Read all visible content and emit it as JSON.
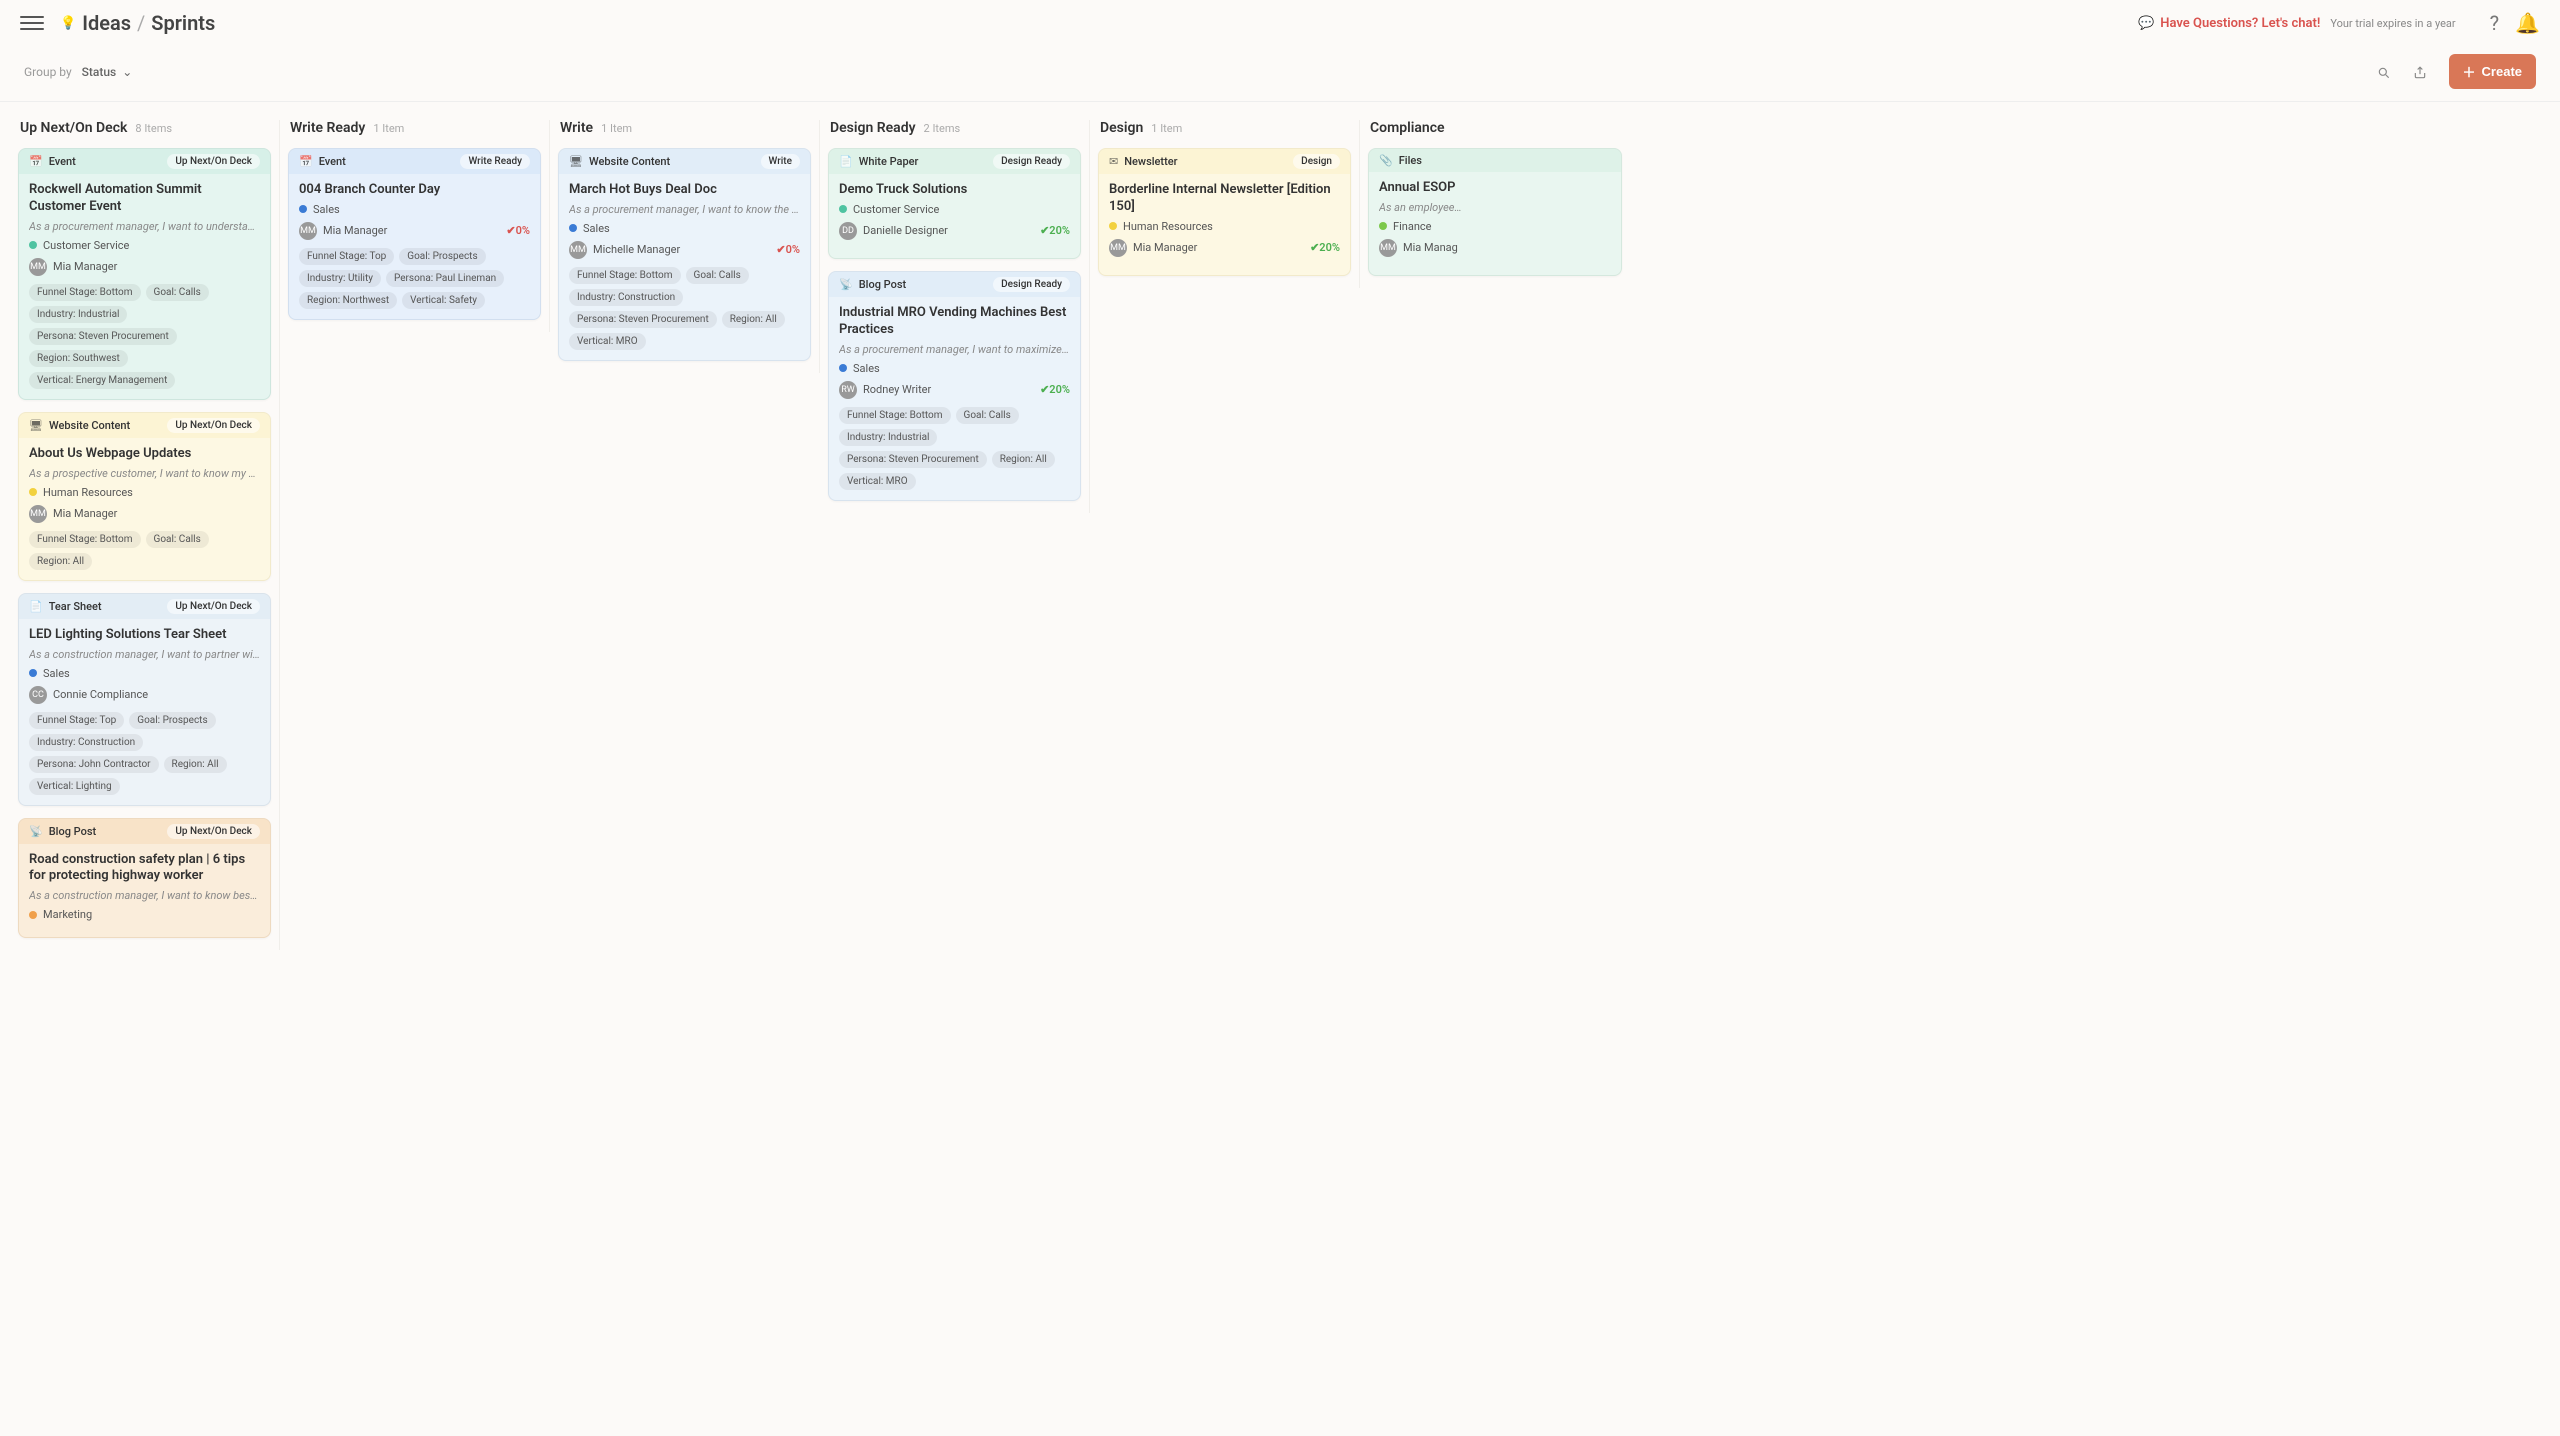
{
  "breadcrumb": {
    "root": "Ideas",
    "current": "Sprints"
  },
  "header": {
    "chat": "Have Questions? Let's chat!",
    "trial": "Your trial expires in a year"
  },
  "toolbar": {
    "group_by_label": "Group by",
    "group_by_value": "Status",
    "create_label": "Create"
  },
  "columns": [
    {
      "title": "Up Next/On Deck",
      "count": "8 Items",
      "cards": [
        {
          "tint": "teal",
          "type_icon": "📅",
          "type": "Event",
          "status": "Up Next/On Deck",
          "title": "Rockwell Automation Summit Customer Event",
          "desc": "As a procurement manager, I want to understand B…",
          "dept_color": "teal",
          "dept": "Customer Service",
          "assignee": "Mia Manager",
          "pct": null,
          "tags": [
            "Funnel Stage: Bottom",
            "Goal: Calls",
            "Industry: Industrial",
            "Persona: Steven Procurement",
            "Region: Southwest",
            "Vertical: Energy Management"
          ]
        },
        {
          "tint": "yellow",
          "type_icon": "🖥",
          "type": "Website Content",
          "status": "Up Next/On Deck",
          "title": "About Us Webpage Updates",
          "desc": "As a prospective customer, I want to know my partn…",
          "dept_color": "yellow",
          "dept": "Human Resources",
          "assignee": "Mia Manager",
          "pct": null,
          "tags": [
            "Funnel Stage: Bottom",
            "Goal: Calls",
            "Region: All"
          ]
        },
        {
          "tint": "bluegrey",
          "type_icon": "📄",
          "type": "Tear Sheet",
          "status": "Up Next/On Deck",
          "title": "LED Lighting Solutions Tear Sheet",
          "desc": "As a construction manager, I want to partner with a …",
          "dept_color": "blue",
          "dept": "Sales",
          "assignee": "Connie Compliance",
          "pct": null,
          "tags": [
            "Funnel Stage: Top",
            "Goal: Prospects",
            "Industry: Construction",
            "Persona: John Contractor",
            "Region: All",
            "Vertical: Lighting"
          ]
        },
        {
          "tint": "orange",
          "type_icon": "📡",
          "type": "Blog Post",
          "status": "Up Next/On Deck",
          "title": "Road construction safety plan | 6 tips for protecting highway worker",
          "desc": "As a construction manager, I want to know best pra…",
          "dept_color": "orange",
          "dept": "Marketing",
          "assignee": null,
          "pct": null,
          "tags": []
        }
      ]
    },
    {
      "title": "Write Ready",
      "count": "1 Item",
      "cards": [
        {
          "tint": "blue",
          "type_icon": "📅",
          "type": "Event",
          "status": "Write Ready",
          "title": "004 Branch Counter Day",
          "desc": null,
          "dept_color": "blue",
          "dept": "Sales",
          "assignee": "Mia Manager",
          "pct": "0%",
          "pct_color": "red",
          "tags": [
            "Funnel Stage: Top",
            "Goal: Prospects",
            "Industry: Utility",
            "Persona: Paul Lineman",
            "Region: Northwest",
            "Vertical: Safety"
          ]
        }
      ]
    },
    {
      "title": "Write",
      "count": "1 Item",
      "cards": [
        {
          "tint": "lblue",
          "type_icon": "🖥",
          "type": "Website Content",
          "status": "Write",
          "title": "March Hot Buys Deal Doc",
          "desc": "As a procurement manager, I want to know the deal…",
          "dept_color": "blue",
          "dept": "Sales",
          "assignee": "Michelle Manager",
          "pct": "0%",
          "pct_color": "red",
          "tags": [
            "Funnel Stage: Bottom",
            "Goal: Calls",
            "Industry: Construction",
            "Persona: Steven Procurement",
            "Region: All",
            "Vertical: MRO"
          ]
        }
      ]
    },
    {
      "title": "Design Ready",
      "count": "2 Items",
      "cards": [
        {
          "tint": "mint",
          "type_icon": "📄",
          "type": "White Paper",
          "status": "Design Ready",
          "title": "Demo Truck Solutions",
          "desc": null,
          "dept_color": "teal",
          "dept": "Customer Service",
          "assignee": "Danielle Designer",
          "pct": "20%",
          "pct_color": "green",
          "tags": []
        },
        {
          "tint": "lblue",
          "type_icon": "📡",
          "type": "Blog Post",
          "status": "Design Ready",
          "title": "Industrial MRO Vending Machines Best Practices",
          "desc": "As a procurement manager, I want to maximize the …",
          "dept_color": "blue",
          "dept": "Sales",
          "assignee": "Rodney Writer",
          "pct": "20%",
          "pct_color": "green",
          "tags": [
            "Funnel Stage: Bottom",
            "Goal: Calls",
            "Industry: Industrial",
            "Persona: Steven Procurement",
            "Region: All",
            "Vertical: MRO"
          ]
        }
      ]
    },
    {
      "title": "Design",
      "count": "1 Item",
      "cards": [
        {
          "tint": "yellow",
          "type_icon": "✉",
          "type": "Newsletter",
          "status": "Design",
          "title": "Borderline Internal Newsletter [Edition 150]",
          "desc": null,
          "dept_color": "yellow",
          "dept": "Human Resources",
          "assignee": "Mia Manager",
          "pct": "20%",
          "pct_color": "green",
          "tags": []
        }
      ]
    },
    {
      "title": "Compliance",
      "count": "",
      "cards": [
        {
          "tint": "mint",
          "type_icon": "📎",
          "type": "Files",
          "status": "",
          "title": "Annual ESOP",
          "desc": "As an employee…",
          "dept_color": "green",
          "dept": "Finance",
          "assignee": "Mia Manag",
          "pct": null,
          "tags": []
        }
      ]
    }
  ]
}
